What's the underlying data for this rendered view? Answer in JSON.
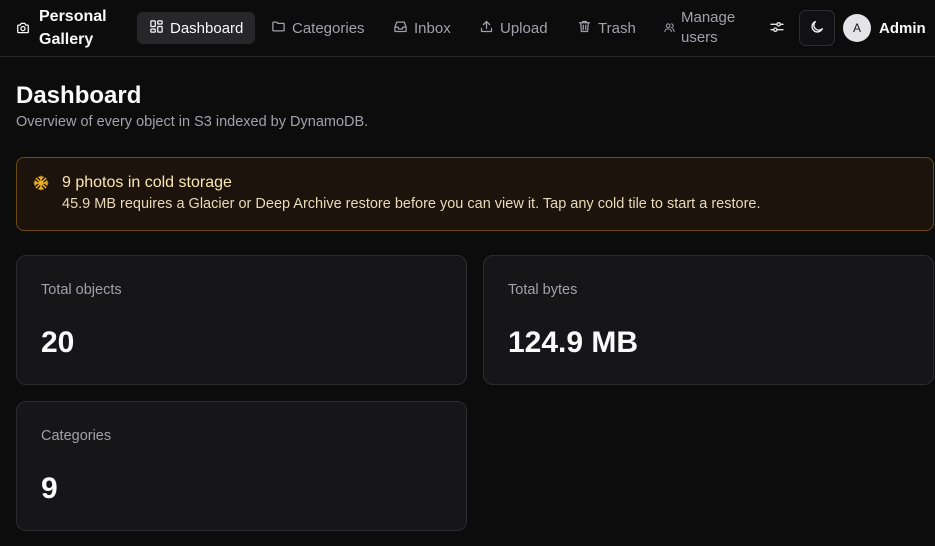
{
  "brand": {
    "name": "Personal Gallery",
    "icon": "camera-icon"
  },
  "nav": {
    "items": [
      {
        "label": "Dashboard",
        "icon": "grid-icon",
        "active": true
      },
      {
        "label": "Categories",
        "icon": "folder-icon"
      },
      {
        "label": "Inbox",
        "icon": "inbox-icon"
      },
      {
        "label": "Upload",
        "icon": "upload-icon"
      },
      {
        "label": "Trash",
        "icon": "trash-icon"
      }
    ],
    "manage_users": "Manage users"
  },
  "toolbar": {
    "settings_icon": "sliders-icon",
    "theme_icon": "moon-icon"
  },
  "user": {
    "initial": "A",
    "name": "Admin"
  },
  "page": {
    "title": "Dashboard",
    "subtitle": "Overview of every object in S3 indexed by DynamoDB."
  },
  "alert": {
    "icon": "snowflake-icon",
    "title": "9 photos in cold storage",
    "body": "45.9 MB requires a Glacier or Deep Archive restore before you can view it. Tap any cold tile to start a restore."
  },
  "stats": [
    {
      "label": "Total objects",
      "value": "20"
    },
    {
      "label": "Total bytes",
      "value": "124.9 MB"
    },
    {
      "label": "Categories",
      "value": "9"
    }
  ],
  "colors": {
    "background": "#0c0c0d",
    "card": "#161618",
    "alert_border": "#6b4a12",
    "alert_icon": "#f0b429",
    "active_nav": "#27272a"
  }
}
